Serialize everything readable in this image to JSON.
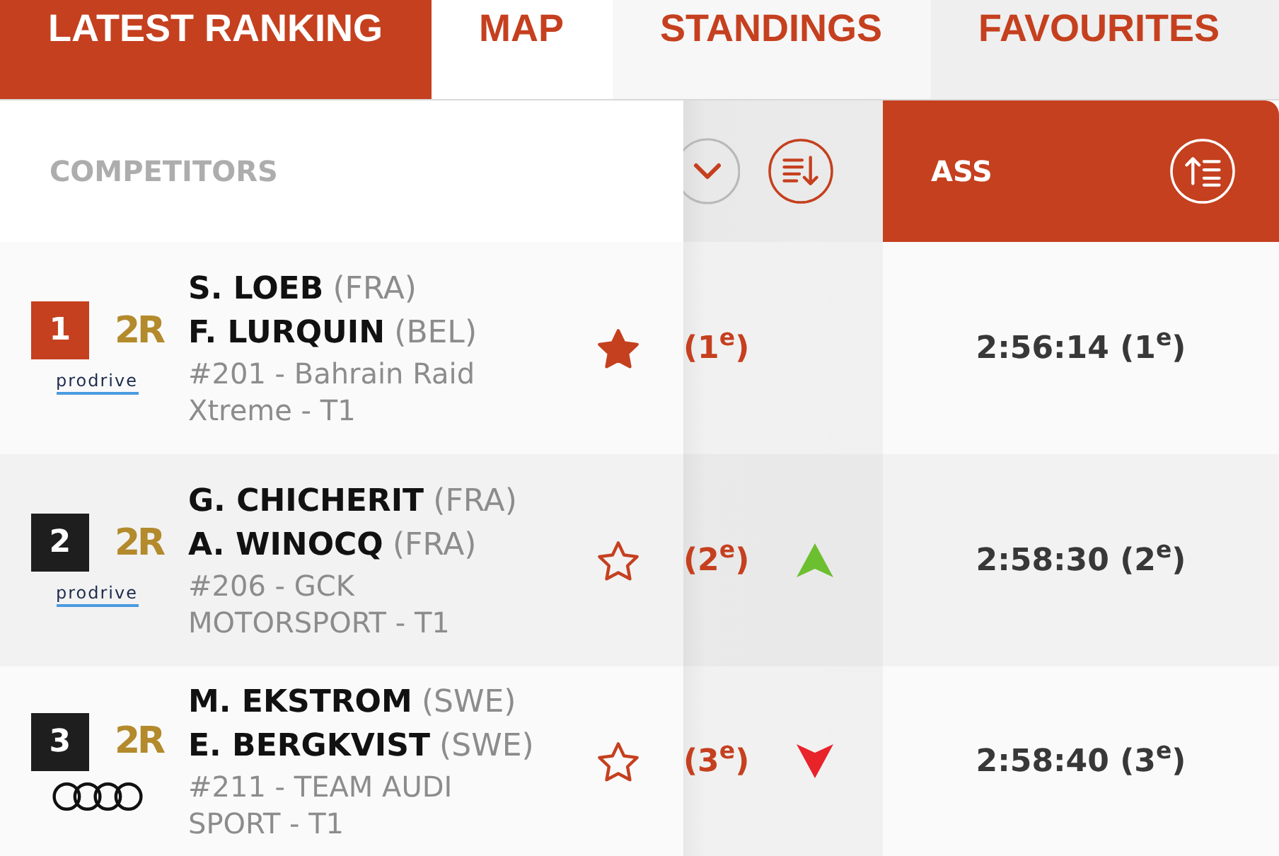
{
  "tabs": [
    {
      "label": "LATEST RANKING",
      "selected": true
    },
    {
      "label": "MAP",
      "selected": false
    },
    {
      "label": "STANDINGS",
      "selected": false
    },
    {
      "label": "FAVOURITES",
      "selected": false
    }
  ],
  "header": {
    "competitors_label": "COMPETITORS",
    "columns": [
      {
        "kind": "descending",
        "active": false
      },
      {
        "kind": "ascending",
        "label": "ASS",
        "active": true
      }
    ]
  },
  "rows": [
    {
      "kind": "steady",
      "position": {
        "text": "1",
        "color": "#c5401f"
      },
      "brand_logo": "2R",
      "team_logo": {
        "kind": "wordmark",
        "text": "prodrive"
      },
      "crew": [
        {
          "name": "S. LOEB",
          "nationality": "(FRA)"
        },
        {
          "name": "F. LURQUIN",
          "nationality": "(BEL)"
        }
      ],
      "entry": "#201 - Bahrain Raid Xtreme - T1",
      "favourite": true,
      "column_2": "(1$^{e}$)",
      "column_3": "2:56:14 (1$^{e}$)"
    },
    {
      "kind": "gained",
      "position": {
        "text": "2",
        "color": "#1e1e1e"
      },
      "brand_logo": "2R",
      "team_logo": {
        "kind": "wordmark",
        "text": "prodrive"
      },
      "crew": [
        {
          "name": "G. CHICHERIT",
          "nationality": "(FRA)"
        },
        {
          "name": "A. WINOCQ",
          "nationality": "(FRA)"
        }
      ],
      "entry": "#206 - GCK MOTORSPORT - T1",
      "favourite": false,
      "column_2": "(2$^{e}$)",
      "column_3": "2:58:30 (2$^{e}$)"
    },
    {
      "kind": "lost",
      "position": {
        "text": "3",
        "color": "#1e1e1e"
      },
      "brand_logo": "2R",
      "team_logo": {
        "kind": "rings"
      },
      "crew": [
        {
          "name": "M. EKSTROM",
          "nationality": "(SWE)"
        },
        {
          "name": "E. BERGKVIST",
          "nationality": "(SWE)"
        }
      ],
      "entry": "#211 - TEAM AUDI SPORT - T1",
      "favourite": false,
      "column_2": "(3$^{e}$)",
      "column_3": "2:58:40 (3$^{e}$)"
    }
  ]
}
